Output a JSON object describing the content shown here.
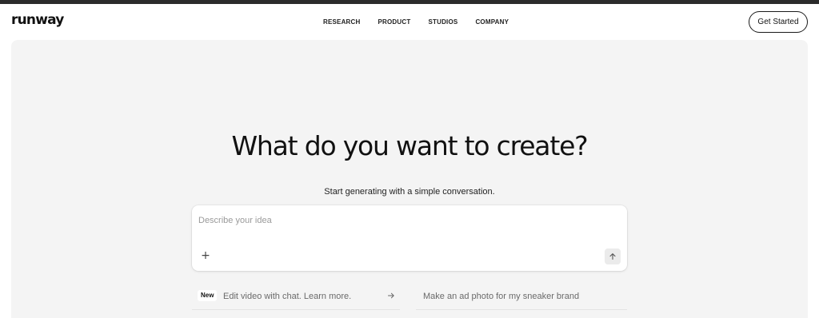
{
  "header": {
    "logo_text": "runway",
    "nav": [
      {
        "label": "RESEARCH"
      },
      {
        "label": "PRODUCT"
      },
      {
        "label": "STUDIOS"
      },
      {
        "label": "COMPANY"
      }
    ],
    "cta_label": "Get Started"
  },
  "hero": {
    "headline": "What do you want to create?",
    "subline": "Start generating with a simple conversation.",
    "prompt": {
      "placeholder": "Describe your idea",
      "value": "",
      "add_icon": "plus-icon",
      "send_icon": "arrow-up-icon"
    },
    "suggestions": [
      {
        "badge": "New",
        "text": "Edit video with chat. Learn more.",
        "icon": "arrow-right-icon"
      },
      {
        "text": "Make an ad photo for my sneaker brand"
      }
    ]
  },
  "colors": {
    "top_bar": "#2b2b2b",
    "hero_background": "#f4f4f4",
    "text": "#111111",
    "muted_text": "#6a6a6a",
    "placeholder": "#9a9a9a"
  }
}
